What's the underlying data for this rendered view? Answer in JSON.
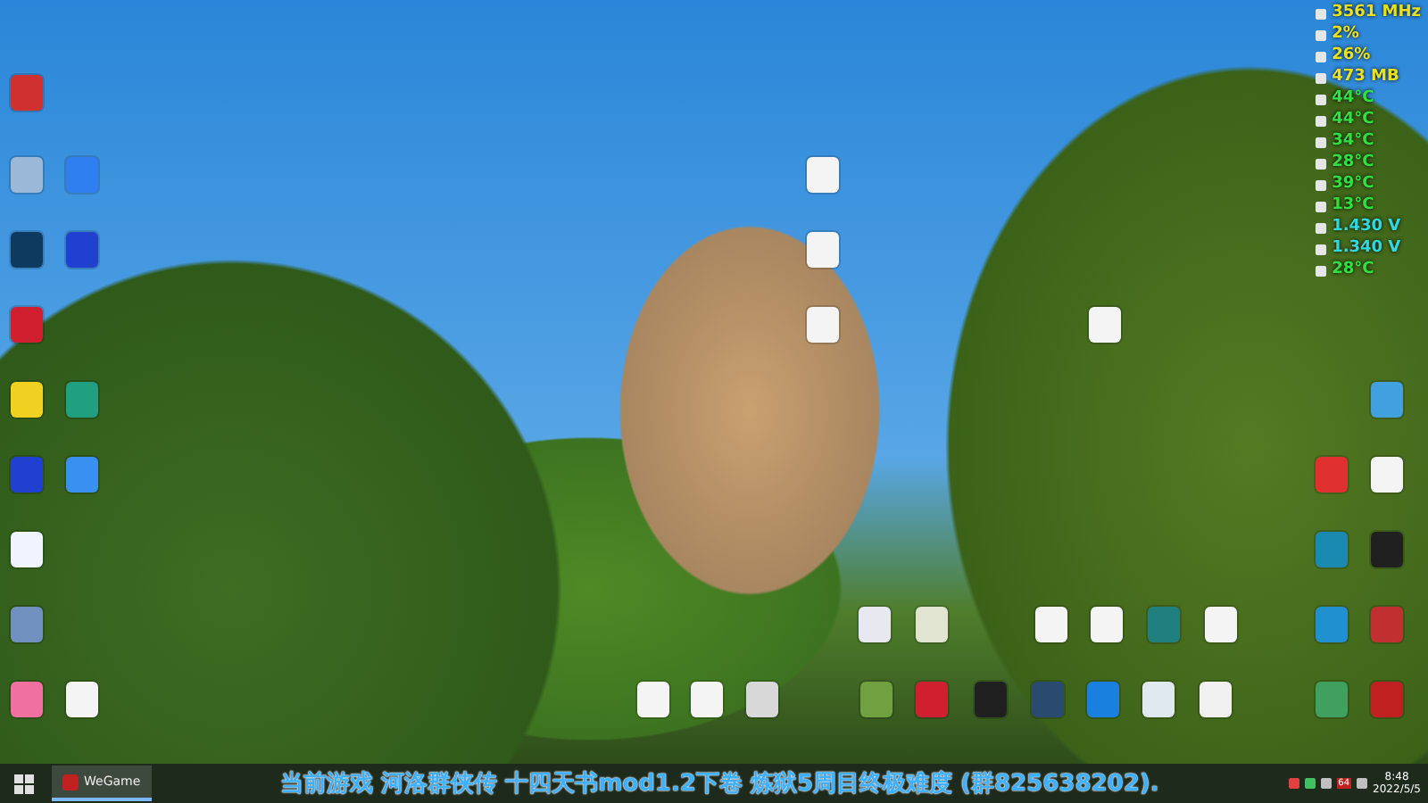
{
  "hardware_monitor": [
    {
      "reading": "3561 MHz",
      "color": "#e8e020"
    },
    {
      "reading": "2%",
      "color": "#e8e020"
    },
    {
      "reading": "26%",
      "color": "#e8e020"
    },
    {
      "reading": "473 MB",
      "color": "#e8e020"
    },
    {
      "reading": "44°C",
      "color": "#30e040"
    },
    {
      "reading": "44°C",
      "color": "#30e040"
    },
    {
      "reading": "34°C",
      "color": "#30e040"
    },
    {
      "reading": "28°C",
      "color": "#30e040"
    },
    {
      "reading": "39°C",
      "color": "#30e040"
    },
    {
      "reading": "13°C",
      "color": "#30e040"
    },
    {
      "reading": "1.430 V",
      "color": "#30d8e0"
    },
    {
      "reading": "1.340 V",
      "color": "#30d8e0"
    },
    {
      "reading": "28°C",
      "color": "#30e040"
    }
  ],
  "taskbar": {
    "apps": [
      {
        "label": "WeGame",
        "selected": true
      }
    ],
    "banner": "当前游戏 河洛群侠传  十四天书mod1.2下卷  炼狱5周目终极难度  (群825638202).",
    "tray_badge": "64",
    "time": "8:48",
    "date": "2022/5/5"
  }
}
